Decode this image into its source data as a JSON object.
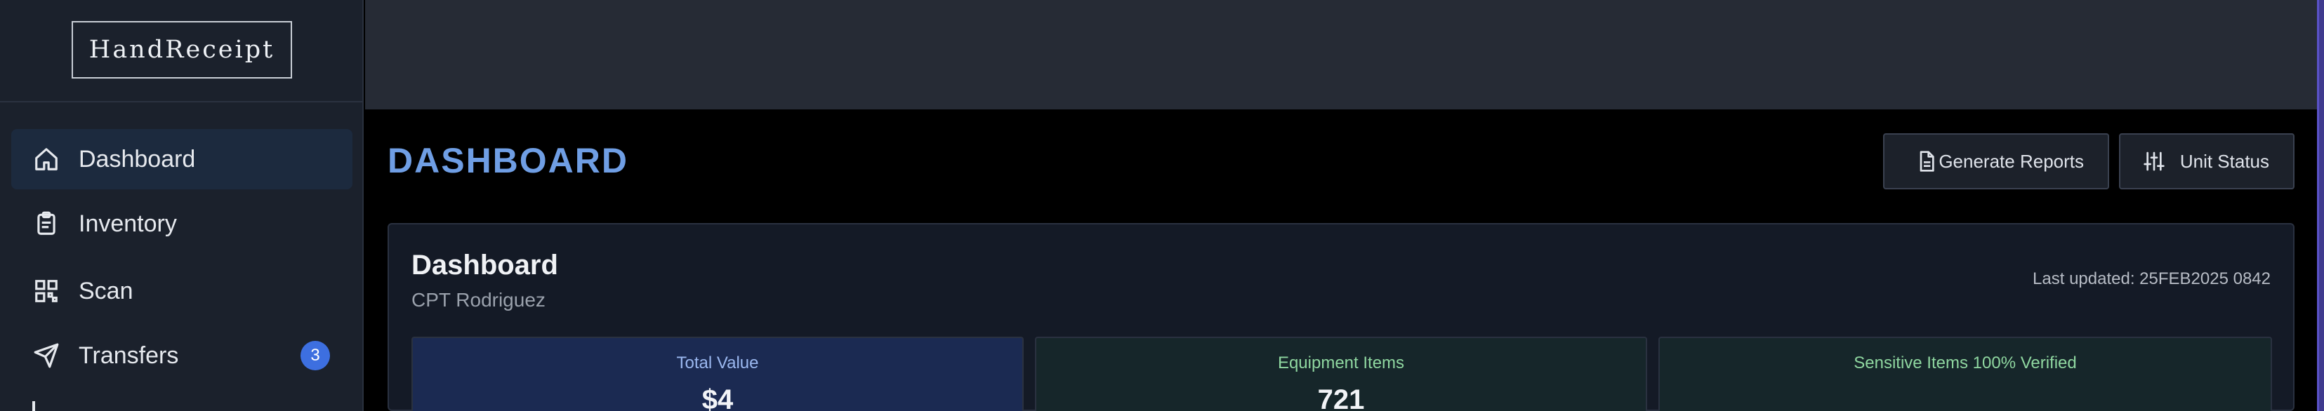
{
  "app": {
    "logo_text": "HandReceipt"
  },
  "sidebar": {
    "items": [
      {
        "label": "Dashboard",
        "icon": "home-icon",
        "active": true
      },
      {
        "label": "Inventory",
        "icon": "clipboard-icon",
        "active": false
      },
      {
        "label": "Scan",
        "icon": "qr-code-icon",
        "active": false
      },
      {
        "label": "Transfers",
        "icon": "send-icon",
        "active": false,
        "badge": "3"
      }
    ]
  },
  "header": {
    "title": "DASHBOARD",
    "buttons": {
      "generate_reports": {
        "label": "Generate Reports",
        "icon": "document-icon"
      },
      "unit_status": {
        "label": "Unit Status",
        "icon": "sliders-icon"
      }
    }
  },
  "card": {
    "title": "Dashboard",
    "subtitle": "CPT Rodriguez",
    "last_updated": "Last updated: 25FEB2025 0842",
    "stats": [
      {
        "label": "Total Value",
        "value": "$4"
      },
      {
        "label": "Equipment Items",
        "value": "721"
      },
      {
        "label": "Sensitive Items 100% Verified",
        "value": ""
      }
    ]
  },
  "colors": {
    "accent": "#6f9ee4",
    "badge": "#3d6fe0",
    "sidebar_bg": "#1b212c",
    "card_bg": "#141a26"
  }
}
